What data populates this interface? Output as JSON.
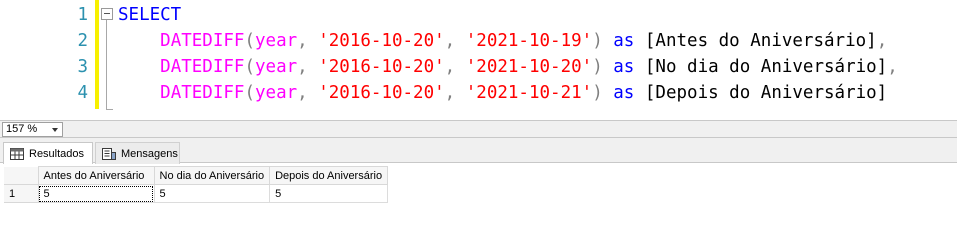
{
  "editor": {
    "line_numbers": [
      "1",
      "2",
      "3",
      "4"
    ],
    "lines": [
      {
        "indent": "",
        "keyword": "SELECT"
      },
      {
        "indent": "    ",
        "fn": "DATEDIFF",
        "open": "(",
        "arg1": "year",
        "comma1": ", ",
        "date_start": "'2016-10-20'",
        "comma2": ", ",
        "date_end": "'2021-10-19'",
        "close": ")",
        "as_kw": " as ",
        "alias": "[Antes do Aniversário]",
        "trail": ","
      },
      {
        "indent": "    ",
        "fn": "DATEDIFF",
        "open": "(",
        "arg1": "year",
        "comma1": ", ",
        "date_start": "'2016-10-20'",
        "comma2": ", ",
        "date_end": "'2021-10-20'",
        "close": ")",
        "as_kw": " as ",
        "alias": "[No dia do Aniversário]",
        "trail": ","
      },
      {
        "indent": "    ",
        "fn": "DATEDIFF",
        "open": "(",
        "arg1": "year",
        "comma1": ", ",
        "date_start": "'2016-10-20'",
        "comma2": ", ",
        "date_end": "'2021-10-21'",
        "close": ")",
        "as_kw": " as ",
        "alias": "[Depois do Aniversário]",
        "trail": ""
      }
    ],
    "colors": {
      "keyword": "#0000ff",
      "function": "#ff00ff",
      "string": "#ff0000",
      "punct": "#808080",
      "line_number": "#2b91af",
      "change_bar": "#f7f000"
    }
  },
  "status": {
    "zoom": "157 %"
  },
  "results": {
    "tabs": [
      {
        "label": "Resultados",
        "icon": "grid-icon",
        "active": true
      },
      {
        "label": "Mensagens",
        "icon": "messages-icon",
        "active": false
      }
    ],
    "columns": [
      "Antes do Aniversário",
      "No dia do Aniversário",
      "Depois do Aniversário"
    ],
    "rows": [
      {
        "row_number": "1",
        "values": [
          "5",
          "5",
          "5"
        ]
      }
    ]
  }
}
